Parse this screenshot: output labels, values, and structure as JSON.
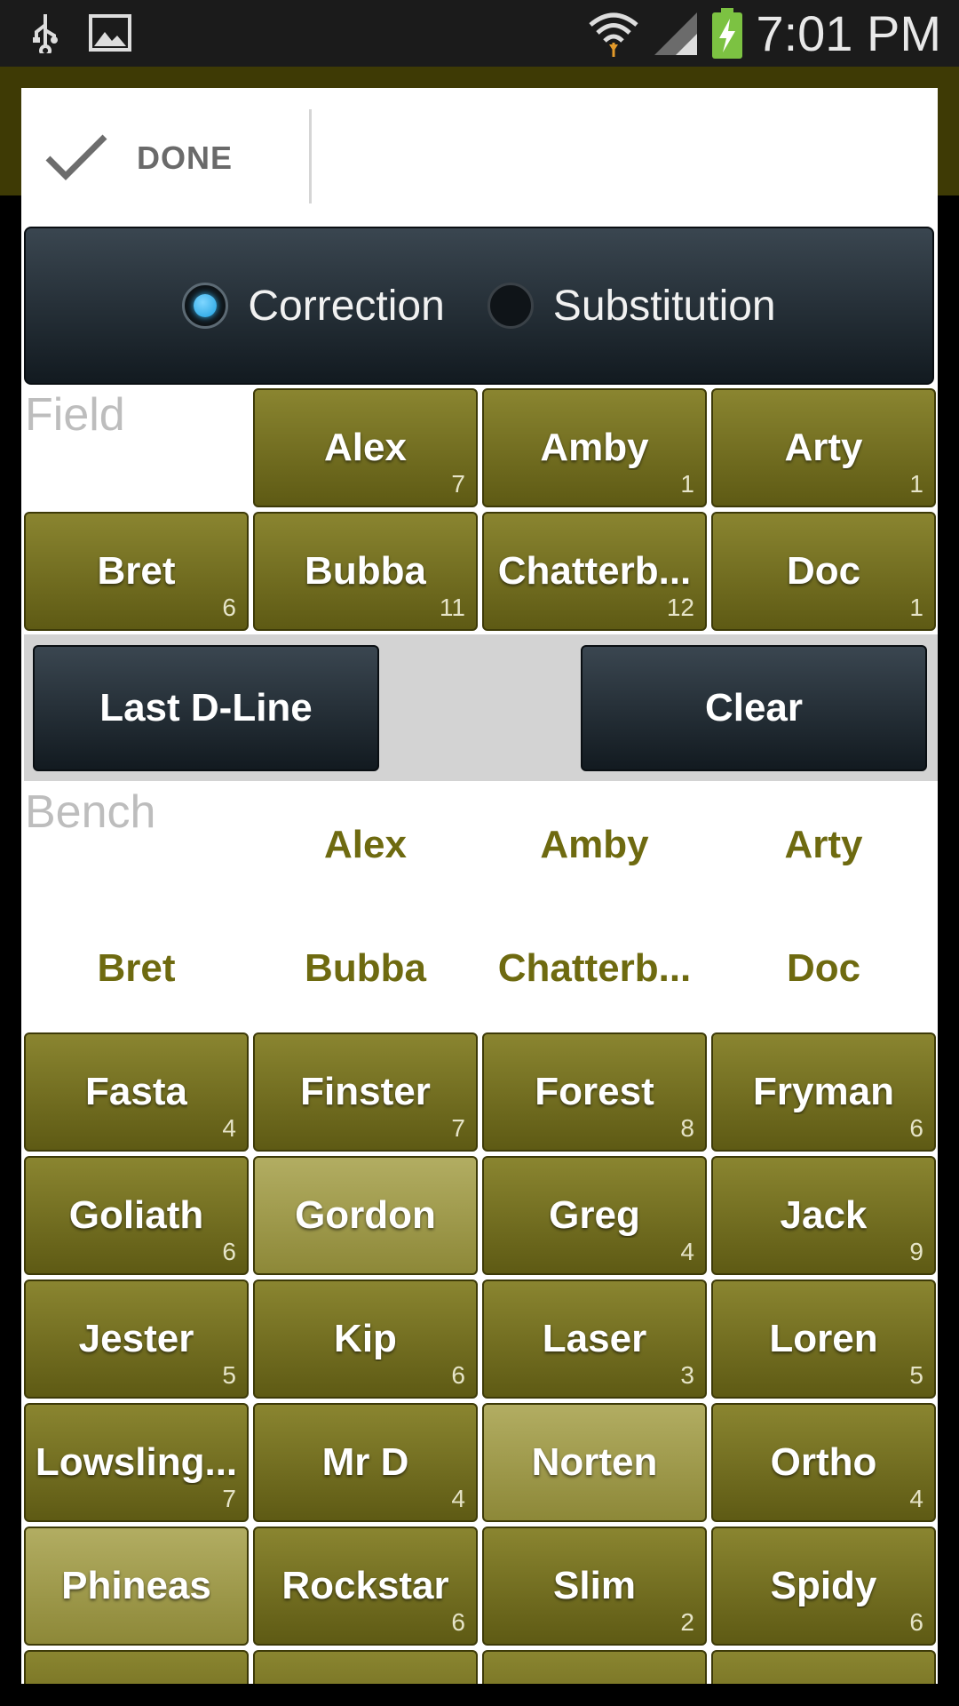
{
  "status_bar": {
    "time": "7:01 PM",
    "icons": [
      "usb-icon",
      "image-icon",
      "wifi-icon",
      "signal-icon",
      "battery-charging-icon"
    ]
  },
  "dialog": {
    "done_label": "DONE",
    "mode": {
      "options": [
        {
          "label": "Correction",
          "selected": true
        },
        {
          "label": "Substitution",
          "selected": false
        }
      ]
    },
    "field_title": "Field",
    "field_players": [
      {
        "name": "Alex",
        "count": "7"
      },
      {
        "name": "Amby",
        "count": "1"
      },
      {
        "name": "Arty",
        "count": "1"
      },
      {
        "name": "Bret",
        "count": "6"
      },
      {
        "name": "Bubba",
        "count": "11"
      },
      {
        "name": "Chatterb...",
        "count": "12"
      },
      {
        "name": "Doc",
        "count": "1"
      }
    ],
    "actions": {
      "last_dline": "Last D-Line",
      "clear": "Clear"
    },
    "bench_title": "Bench",
    "bench_placeholders": [
      "Alex",
      "Amby",
      "Arty",
      "Bret",
      "Bubba",
      "Chatterb...",
      "Doc"
    ],
    "bench_players": [
      {
        "name": "Fasta",
        "count": "4"
      },
      {
        "name": "Finster",
        "count": "7"
      },
      {
        "name": "Forest",
        "count": "8"
      },
      {
        "name": "Fryman",
        "count": "6"
      },
      {
        "name": "Goliath",
        "count": "6"
      },
      {
        "name": "Gordon",
        "count": ""
      },
      {
        "name": "Greg",
        "count": "4"
      },
      {
        "name": "Jack",
        "count": "9"
      },
      {
        "name": "Jester",
        "count": "5"
      },
      {
        "name": "Kip",
        "count": "6"
      },
      {
        "name": "Laser",
        "count": "3"
      },
      {
        "name": "Loren",
        "count": "5"
      },
      {
        "name": "Lowsling...",
        "count": "7"
      },
      {
        "name": "Mr D",
        "count": "4"
      },
      {
        "name": "Norten",
        "count": ""
      },
      {
        "name": "Ortho",
        "count": "4"
      },
      {
        "name": "Phineas",
        "count": ""
      },
      {
        "name": "Rockstar",
        "count": "6"
      },
      {
        "name": "Slim",
        "count": "2"
      },
      {
        "name": "Spidy",
        "count": "6"
      }
    ]
  }
}
